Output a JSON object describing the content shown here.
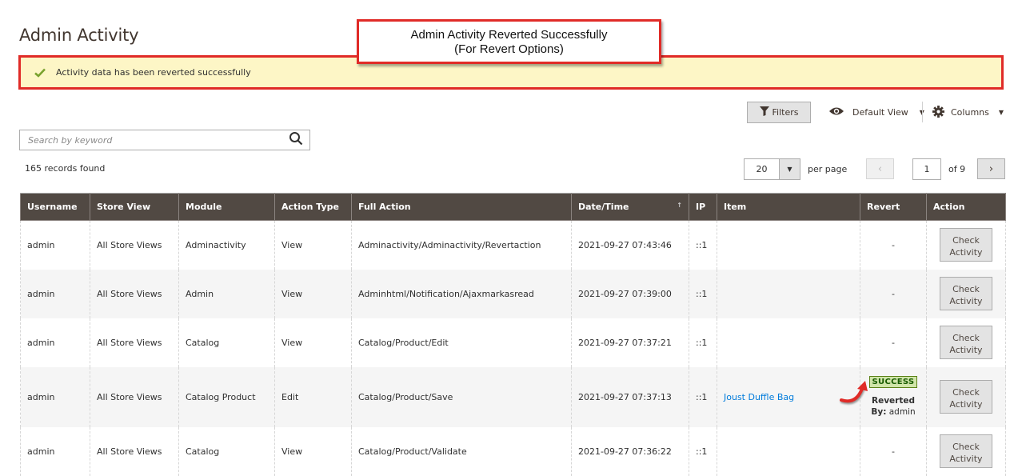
{
  "page": {
    "title": "Admin Activity"
  },
  "message": {
    "text": "Activity data has been reverted successfully",
    "type": "success",
    "icon": "checkmark-icon"
  },
  "annotation": {
    "line1": "Admin Activity Reverted Successfully",
    "line2": "(For Revert Options)"
  },
  "toolbar": {
    "filters_label": "Filters",
    "view_label": "Default View",
    "columns_label": "Columns"
  },
  "search": {
    "placeholder": "Search by keyword",
    "value": ""
  },
  "records": {
    "text": "165 records found"
  },
  "pagination": {
    "per_page": "20",
    "per_page_label": "per page",
    "current_page": "1",
    "total_label": "of 9",
    "prev_icon": "‹",
    "next_icon": "›"
  },
  "grid": {
    "columns": [
      "Username",
      "Store View",
      "Module",
      "Action Type",
      "Full Action",
      "Date/Time",
      "IP",
      "Item",
      "Revert",
      "Action"
    ],
    "sort_indicator": "↑",
    "action_button_line1": "Check",
    "action_button_line2": "Activity",
    "rows": [
      {
        "username": "admin",
        "store_view": "All Store Views",
        "module": "Adminactivity",
        "action_type": "View",
        "full_action": "Adminactivity/Adminactivity/Revertaction",
        "datetime": "2021-09-27 07:43:46",
        "ip": "::1",
        "item": "",
        "revert": "-"
      },
      {
        "username": "admin",
        "store_view": "All Store Views",
        "module": "Admin",
        "action_type": "View",
        "full_action": "Adminhtml/Notification/Ajaxmarkasread",
        "datetime": "2021-09-27 07:39:00",
        "ip": "::1",
        "item": "",
        "revert": "-"
      },
      {
        "username": "admin",
        "store_view": "All Store Views",
        "module": "Catalog",
        "action_type": "View",
        "full_action": "Catalog/Product/Edit",
        "datetime": "2021-09-27 07:37:21",
        "ip": "::1",
        "item": "",
        "revert": "-"
      },
      {
        "username": "admin",
        "store_view": "All Store Views",
        "module": "Catalog Product",
        "action_type": "Edit",
        "full_action": "Catalog/Product/Save",
        "datetime": "2021-09-27 07:37:13",
        "ip": "::1",
        "item": "Joust Duffle Bag",
        "revert_status": "SUCCESS",
        "reverted_label": "Reverted",
        "reverted_by_label": "By:",
        "reverted_by": "admin"
      },
      {
        "username": "admin",
        "store_view": "All Store Views",
        "module": "Catalog",
        "action_type": "View",
        "full_action": "Catalog/Product/Validate",
        "datetime": "2021-09-27 07:36:22",
        "ip": "::1",
        "item": "",
        "revert": "-"
      }
    ]
  },
  "colors": {
    "header_bg": "#514943",
    "message_bg": "#fdf6c6",
    "annotation_border": "#e02b27",
    "link": "#007bdb",
    "success_bg": "#d0e5a9"
  }
}
